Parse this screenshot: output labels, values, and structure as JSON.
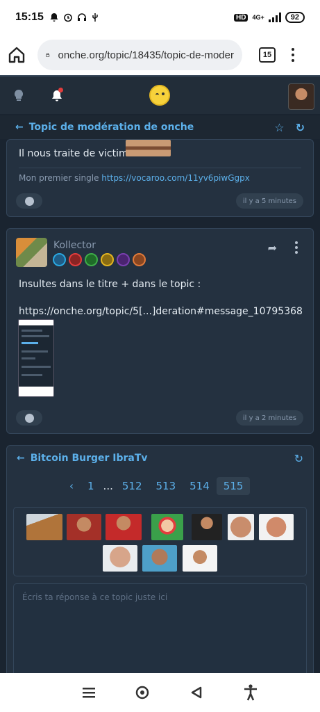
{
  "status_bar": {
    "time": "15:15",
    "hd_label": "HD",
    "network": "4G+",
    "battery": "92"
  },
  "browser": {
    "url": "onche.org/topic/18435/topic-de-moder",
    "tab_count": "15"
  },
  "topic_bar": {
    "title": "Topic de modération de onche"
  },
  "message1": {
    "text": "Il nous traite de victime",
    "signature_prefix": "Mon premier single",
    "signature_link": "https://vocaroo.com/11yv6piwGgpx",
    "time": "il y a 5 minutes"
  },
  "message2": {
    "author": "Kollector",
    "line1": "Insultes dans le titre + dans le topic :",
    "line2": "https://onche.org/topic/5[...]deration#message_10795368",
    "time": "il y a 2 minutes",
    "badge_colors": [
      "#2aa7e0",
      "#e23d3d",
      "#3fae49",
      "#e3b520",
      "#7a3fb0",
      "#e07a3a"
    ]
  },
  "topic2": {
    "title": "Bitcoin Burger IbraTv",
    "pagination": {
      "prev": "‹",
      "first": "1",
      "dots": "...",
      "pages": [
        "512",
        "513",
        "514"
      ],
      "current": "515"
    },
    "reply_placeholder": "Écris ta réponse à ce topic juste ici"
  },
  "colors": {
    "accent": "#5cb0ea",
    "background": "#1a2430",
    "card": "#243140"
  }
}
